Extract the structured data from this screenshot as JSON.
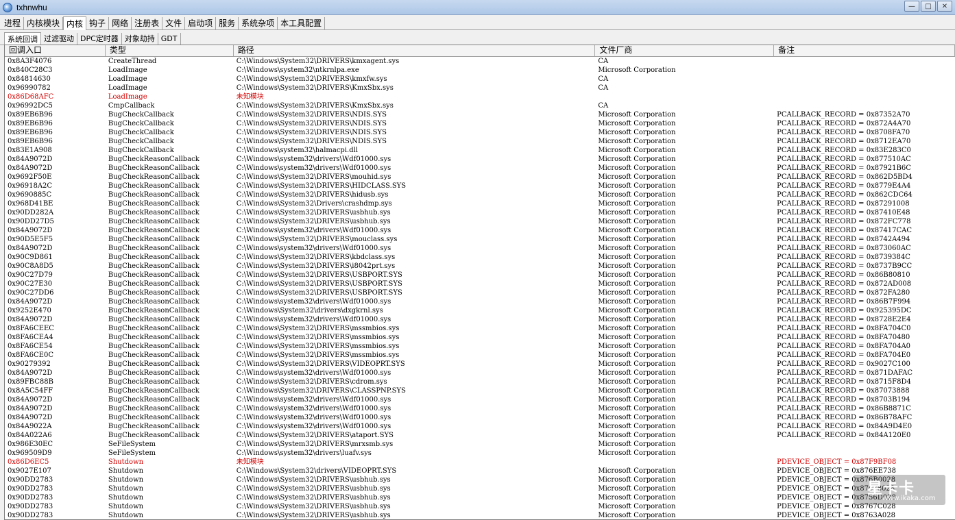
{
  "window": {
    "title": "txhnwhu",
    "minimize": "—",
    "maximize": "□",
    "close": "✕"
  },
  "tabs": [
    {
      "label": "进程",
      "active": false
    },
    {
      "label": "内核模块",
      "active": false
    },
    {
      "label": "内核",
      "active": true
    },
    {
      "label": "钩子",
      "active": false
    },
    {
      "label": "网络",
      "active": false
    },
    {
      "label": "注册表",
      "active": false
    },
    {
      "label": "文件",
      "active": false
    },
    {
      "label": "启动项",
      "active": false
    },
    {
      "label": "服务",
      "active": false
    },
    {
      "label": "系统杂项",
      "active": false
    },
    {
      "label": "本工具配置",
      "active": false
    }
  ],
  "subtabs": [
    {
      "label": "系统回调",
      "active": true
    },
    {
      "label": "过滤驱动",
      "active": false
    },
    {
      "label": "DPC定时器",
      "active": false
    },
    {
      "label": "对象劫持",
      "active": false
    },
    {
      "label": "GDT",
      "active": false
    }
  ],
  "table": {
    "columns": [
      "回调入口",
      "类型",
      "路径",
      "文件厂商",
      "备注"
    ],
    "rows": [
      [
        "0x8A3F4076",
        "CreateThread",
        "C:\\Windows\\System32\\DRIVERS\\kmxagent.sys",
        "CA",
        ""
      ],
      [
        "0x840C28C3",
        "LoadImage",
        "C:\\Windows\\system32\\ntkrnlpa.exe",
        "Microsoft Corporation",
        ""
      ],
      [
        "0x84814630",
        "LoadImage",
        "C:\\Windows\\System32\\DRIVERS\\kmxfw.sys",
        "CA",
        ""
      ],
      [
        "0x96990782",
        "LoadImage",
        "C:\\Windows\\System32\\DRIVERS\\KmxSbx.sys",
        "CA",
        ""
      ],
      [
        "0x86D68AFC",
        "LoadImage",
        "未知模块",
        "",
        ""
      ],
      [
        "0x96992DC5",
        "CmpCallback",
        "C:\\Windows\\System32\\DRIVERS\\KmxSbx.sys",
        "CA",
        ""
      ],
      [
        "0x89EB6B96",
        "BugCheckCallback",
        "C:\\Windows\\System32\\DRIVERS\\NDIS.SYS",
        "Microsoft Corporation",
        "PCALLBACK_RECORD = 0x87352A70"
      ],
      [
        "0x89EB6B96",
        "BugCheckCallback",
        "C:\\Windows\\System32\\DRIVERS\\NDIS.SYS",
        "Microsoft Corporation",
        "PCALLBACK_RECORD = 0x872A4A70"
      ],
      [
        "0x89EB6B96",
        "BugCheckCallback",
        "C:\\Windows\\System32\\DRIVERS\\NDIS.SYS",
        "Microsoft Corporation",
        "PCALLBACK_RECORD = 0x8708FA70"
      ],
      [
        "0x89EB6B96",
        "BugCheckCallback",
        "C:\\Windows\\System32\\DRIVERS\\NDIS.SYS",
        "Microsoft Corporation",
        "PCALLBACK_RECORD = 0x8712EA70"
      ],
      [
        "0x83E1A908",
        "BugCheckCallback",
        "C:\\Windows\\system32\\halmacpi.dll",
        "Microsoft Corporation",
        "PCALLBACK_RECORD = 0x83E283C0"
      ],
      [
        "0x84A9072D",
        "BugCheckReasonCallback",
        "C:\\Windows\\system32\\drivers\\Wdf01000.sys",
        "Microsoft Corporation",
        "PCALLBACK_RECORD = 0x877510AC"
      ],
      [
        "0x84A9072D",
        "BugCheckReasonCallback",
        "C:\\Windows\\system32\\drivers\\Wdf01000.sys",
        "Microsoft Corporation",
        "PCALLBACK_RECORD = 0x87921B6C"
      ],
      [
        "0x9692F50E",
        "BugCheckReasonCallback",
        "C:\\Windows\\System32\\DRIVERS\\mouhid.sys",
        "Microsoft Corporation",
        "PCALLBACK_RECORD = 0x862D5BD4"
      ],
      [
        "0x96918A2C",
        "BugCheckReasonCallback",
        "C:\\Windows\\System32\\DRIVERS\\HIDCLASS.SYS",
        "Microsoft Corporation",
        "PCALLBACK_RECORD = 0x8779E4A4"
      ],
      [
        "0x9690885C",
        "BugCheckReasonCallback",
        "C:\\Windows\\System32\\DRIVERS\\hidusb.sys",
        "Microsoft Corporation",
        "PCALLBACK_RECORD = 0x862CDC64"
      ],
      [
        "0x968D41BE",
        "BugCheckReasonCallback",
        "C:\\Windows\\System32\\Drivers\\crashdmp.sys",
        "Microsoft Corporation",
        "PCALLBACK_RECORD = 0x87291008"
      ],
      [
        "0x90DD282A",
        "BugCheckReasonCallback",
        "C:\\Windows\\System32\\DRIVERS\\usbhub.sys",
        "Microsoft Corporation",
        "PCALLBACK_RECORD = 0x87410E48"
      ],
      [
        "0x90DD27D5",
        "BugCheckReasonCallback",
        "C:\\Windows\\System32\\DRIVERS\\usbhub.sys",
        "Microsoft Corporation",
        "PCALLBACK_RECORD = 0x872FC778"
      ],
      [
        "0x84A9072D",
        "BugCheckReasonCallback",
        "C:\\Windows\\system32\\drivers\\Wdf01000.sys",
        "Microsoft Corporation",
        "PCALLBACK_RECORD = 0x87417CAC"
      ],
      [
        "0x90D5E5F5",
        "BugCheckReasonCallback",
        "C:\\Windows\\System32\\DRIVERS\\mouclass.sys",
        "Microsoft Corporation",
        "PCALLBACK_RECORD = 0x8742A494"
      ],
      [
        "0x84A9072D",
        "BugCheckReasonCallback",
        "C:\\Windows\\system32\\drivers\\Wdf01000.sys",
        "Microsoft Corporation",
        "PCALLBACK_RECORD = 0x873060AC"
      ],
      [
        "0x90C9D861",
        "BugCheckReasonCallback",
        "C:\\Windows\\System32\\DRIVERS\\kbdclass.sys",
        "Microsoft Corporation",
        "PCALLBACK_RECORD = 0x8739384C"
      ],
      [
        "0x90C8A8D5",
        "BugCheckReasonCallback",
        "C:\\Windows\\System32\\DRIVERS\\i8042prt.sys",
        "Microsoft Corporation",
        "PCALLBACK_RECORD = 0x8737B9CC"
      ],
      [
        "0x90C27D79",
        "BugCheckReasonCallback",
        "C:\\Windows\\System32\\DRIVERS\\USBPORT.SYS",
        "Microsoft Corporation",
        "PCALLBACK_RECORD = 0x86B80810"
      ],
      [
        "0x90C27E30",
        "BugCheckReasonCallback",
        "C:\\Windows\\System32\\DRIVERS\\USBPORT.SYS",
        "Microsoft Corporation",
        "PCALLBACK_RECORD = 0x872AD008"
      ],
      [
        "0x90C27DD6",
        "BugCheckReasonCallback",
        "C:\\Windows\\System32\\DRIVERS\\USBPORT.SYS",
        "Microsoft Corporation",
        "PCALLBACK_RECORD = 0x872FA280"
      ],
      [
        "0x84A9072D",
        "BugCheckReasonCallback",
        "C:\\Windows\\system32\\drivers\\Wdf01000.sys",
        "Microsoft Corporation",
        "PCALLBACK_RECORD = 0x86B7F994"
      ],
      [
        "0x9252E470",
        "BugCheckReasonCallback",
        "C:\\Windows\\System32\\drivers\\dxgkrnl.sys",
        "Microsoft Corporation",
        "PCALLBACK_RECORD = 0x925395DC"
      ],
      [
        "0x84A9072D",
        "BugCheckReasonCallback",
        "C:\\Windows\\system32\\drivers\\Wdf01000.sys",
        "Microsoft Corporation",
        "PCALLBACK_RECORD = 0x8728E2E4"
      ],
      [
        "0x8FA6CEEC",
        "BugCheckReasonCallback",
        "C:\\Windows\\System32\\DRIVERS\\mssmbios.sys",
        "Microsoft Corporation",
        "PCALLBACK_RECORD = 0x8FA704C0"
      ],
      [
        "0x8FA6CEA4",
        "BugCheckReasonCallback",
        "C:\\Windows\\System32\\DRIVERS\\mssmbios.sys",
        "Microsoft Corporation",
        "PCALLBACK_RECORD = 0x8FA70480"
      ],
      [
        "0x8FA6CE54",
        "BugCheckReasonCallback",
        "C:\\Windows\\System32\\DRIVERS\\mssmbios.sys",
        "Microsoft Corporation",
        "PCALLBACK_RECORD = 0x8FA704A0"
      ],
      [
        "0x8FA6CE0C",
        "BugCheckReasonCallback",
        "C:\\Windows\\System32\\DRIVERS\\mssmbios.sys",
        "Microsoft Corporation",
        "PCALLBACK_RECORD = 0x8FA704E0"
      ],
      [
        "0x90279392",
        "BugCheckReasonCallback",
        "C:\\Windows\\System32\\DRIVERS\\VIDEOPRT.SYS",
        "Microsoft Corporation",
        "PCALLBACK_RECORD = 0x9027C100"
      ],
      [
        "0x84A9072D",
        "BugCheckReasonCallback",
        "C:\\Windows\\system32\\drivers\\Wdf01000.sys",
        "Microsoft Corporation",
        "PCALLBACK_RECORD = 0x871DAFAC"
      ],
      [
        "0x89FBC88B",
        "BugCheckReasonCallback",
        "C:\\Windows\\System32\\DRIVERS\\cdrom.sys",
        "Microsoft Corporation",
        "PCALLBACK_RECORD = 0x8715F8D4"
      ],
      [
        "0x8A5C54FF",
        "BugCheckReasonCallback",
        "C:\\Windows\\System32\\DRIVERS\\CLASSPNP.SYS",
        "Microsoft Corporation",
        "PCALLBACK_RECORD = 0x87073888"
      ],
      [
        "0x84A9072D",
        "BugCheckReasonCallback",
        "C:\\Windows\\system32\\drivers\\Wdf01000.sys",
        "Microsoft Corporation",
        "PCALLBACK_RECORD = 0x8703B194"
      ],
      [
        "0x84A9072D",
        "BugCheckReasonCallback",
        "C:\\Windows\\system32\\drivers\\Wdf01000.sys",
        "Microsoft Corporation",
        "PCALLBACK_RECORD = 0x86B8871C"
      ],
      [
        "0x84A9072D",
        "BugCheckReasonCallback",
        "C:\\Windows\\system32\\drivers\\Wdf01000.sys",
        "Microsoft Corporation",
        "PCALLBACK_RECORD = 0x86B78AFC"
      ],
      [
        "0x84A9022A",
        "BugCheckReasonCallback",
        "C:\\Windows\\system32\\drivers\\Wdf01000.sys",
        "Microsoft Corporation",
        "PCALLBACK_RECORD = 0x84A9D4E0"
      ],
      [
        "0x84A022A6",
        "BugCheckReasonCallback",
        "C:\\Windows\\System32\\DRIVERS\\ataport.SYS",
        "Microsoft Corporation",
        "PCALLBACK_RECORD = 0x84A120E0"
      ],
      [
        "0x986E30EC",
        "SeFileSystem",
        "C:\\Windows\\System32\\DRIVERS\\mrxsmb.sys",
        "Microsoft Corporation",
        ""
      ],
      [
        "0x969509D9",
        "SeFileSystem",
        "C:\\Windows\\system32\\drivers\\luafv.sys",
        "Microsoft Corporation",
        ""
      ],
      [
        "0x86D6EC5",
        "Shutdown",
        "未知模块",
        "",
        "PDEVICE_OBJECT = 0x87F9BF08"
      ],
      [
        "0x9027E107",
        "Shutdown",
        "C:\\Windows\\System32\\drivers\\VIDEOPRT.SYS",
        "Microsoft Corporation",
        "PDEVICE_OBJECT = 0x876EE738"
      ],
      [
        "0x90DD2783",
        "Shutdown",
        "C:\\Windows\\System32\\DRIVERS\\usbhub.sys",
        "Microsoft Corporation",
        "PDEVICE_OBJECT = 0x876B0028"
      ],
      [
        "0x90DD2783",
        "Shutdown",
        "C:\\Windows\\System32\\DRIVERS\\usbhub.sys",
        "Microsoft Corporation",
        "PDEVICE_OBJECT = 0x87678028"
      ],
      [
        "0x90DD2783",
        "Shutdown",
        "C:\\Windows\\System32\\DRIVERS\\usbhub.sys",
        "Microsoft Corporation",
        "PDEVICE_OBJECT = 0x8756D028"
      ],
      [
        "0x90DD2783",
        "Shutdown",
        "C:\\Windows\\System32\\DRIVERS\\usbhub.sys",
        "Microsoft Corporation",
        "PDEVICE_OBJECT = 0x8767C028"
      ],
      [
        "0x90DD2783",
        "Shutdown",
        "C:\\Windows\\System32\\DRIVERS\\usbhub.sys",
        "Microsoft Corporation",
        "PDEVICE_OBJECT = 0x8763A028"
      ]
    ],
    "alert_rows": [
      4,
      45
    ],
    "alert_color": "#d40000"
  },
  "watermark": {
    "main": "星卡卡",
    "sub": "www.ikaka.com"
  }
}
